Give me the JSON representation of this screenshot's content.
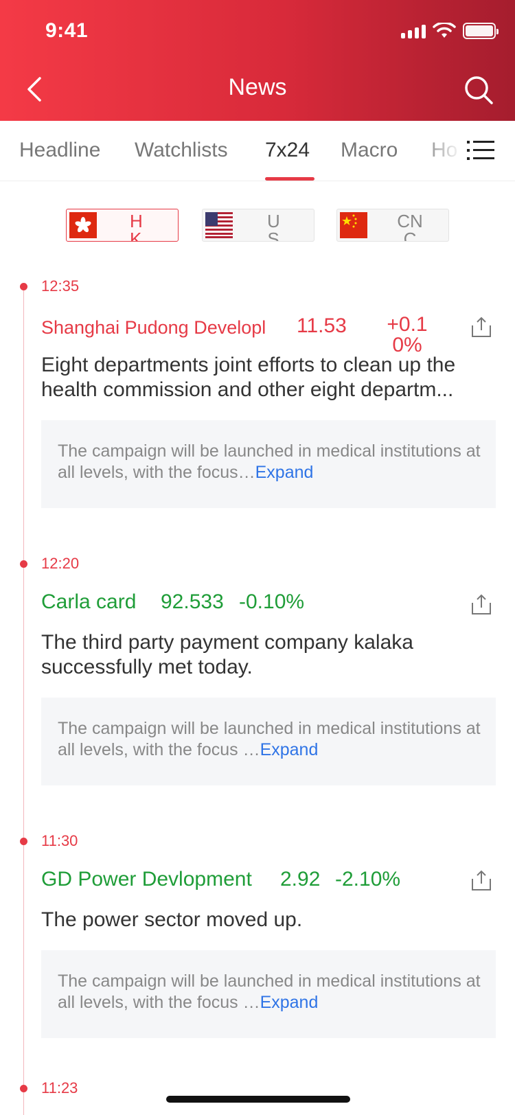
{
  "status_bar": {
    "time": "9:41"
  },
  "nav": {
    "title": "News"
  },
  "tabs": [
    {
      "label": "Headline"
    },
    {
      "label": "Watchlists"
    },
    {
      "label": "7x24"
    },
    {
      "label": "Macro"
    },
    {
      "label": "Ho"
    }
  ],
  "markets": [
    {
      "label": "HK"
    },
    {
      "label": "US"
    },
    {
      "label": "CNC"
    }
  ],
  "news": [
    {
      "time": "12:35",
      "stock_name": "Shanghai Pudong Developl",
      "price": "11.53",
      "change": "+0.10%",
      "headline": "Eight departments joint efforts to clean up the health commission and other eight departm...",
      "summary": "The campaign will be launched in medical institutions at all levels, with the focus…",
      "expand": "Expand"
    },
    {
      "time": "12:20",
      "stock_name": "Carla card",
      "price": "92.533",
      "change": "-0.10%",
      "headline": "The third party payment company kalaka successfully met today.",
      "summary": "The campaign will be launched in medical institutions at all levels, with the focus …",
      "expand": "Expand"
    },
    {
      "time": "11:30",
      "stock_name": "GD Power Devlopment",
      "price": "2.92",
      "change": "-2.10%",
      "headline": "The power sector moved up.",
      "summary": "The campaign will be launched in medical institutions at all levels, with the focus …",
      "expand": "Expand"
    },
    {
      "time": "11:23"
    }
  ],
  "colors": {
    "accent": "#e63a46",
    "up": "#e63a46",
    "down": "#1f9d38",
    "link": "#2f74e6"
  }
}
